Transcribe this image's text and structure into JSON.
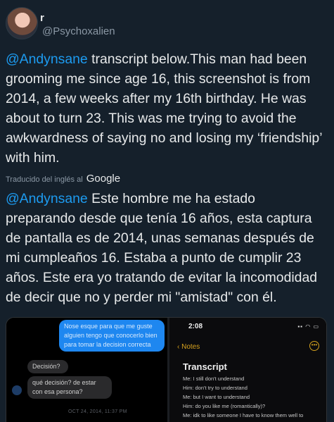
{
  "user": {
    "display_name": "r",
    "handle": "@Psychoxalien"
  },
  "tweet": {
    "mention": "@Andynsane",
    "original_rest": " transcript below.This man had been grooming me since age 16, this screenshot is from 2014, a few weeks after my 16th birthday. He was about to turn 23. This was me trying to avoid the awkwardness of saying no and losing my ‘friendship’ with him.",
    "translation_note": "Traducido del inglés al",
    "translation_brand": "Google",
    "translated_mention": "@Andynsane",
    "translated_rest": " Este hombre me ha estado preparando desde que tenía 16 años, esta captura de pantalla es de 2014, unas semanas después de mi cumpleaños 16. Estaba a punto de cumplir 23 años. Este era yo tratando de evitar la incomodidad de decir que no y perder mi \"amistad\" con él."
  },
  "media": {
    "chat": {
      "sent_message": "Nose esque para que me guste alguien tengo que conocerlo bien para tomar la decision correcta",
      "received_1": "Decisión?",
      "received_2": "qué decisión? de estar con esa persona?",
      "timestamp": "OCT 24, 2014, 11:37 PM"
    },
    "notes": {
      "time": "2:08",
      "back_label": "Notes",
      "title": "Transcript",
      "lines": [
        "Me: I still don't understand",
        "Him: don't try to understand",
        "Me: but I want to understand",
        "Him: do you like me (romantically)?",
        "Me: idk to like someone I have to know them well to"
      ]
    }
  }
}
